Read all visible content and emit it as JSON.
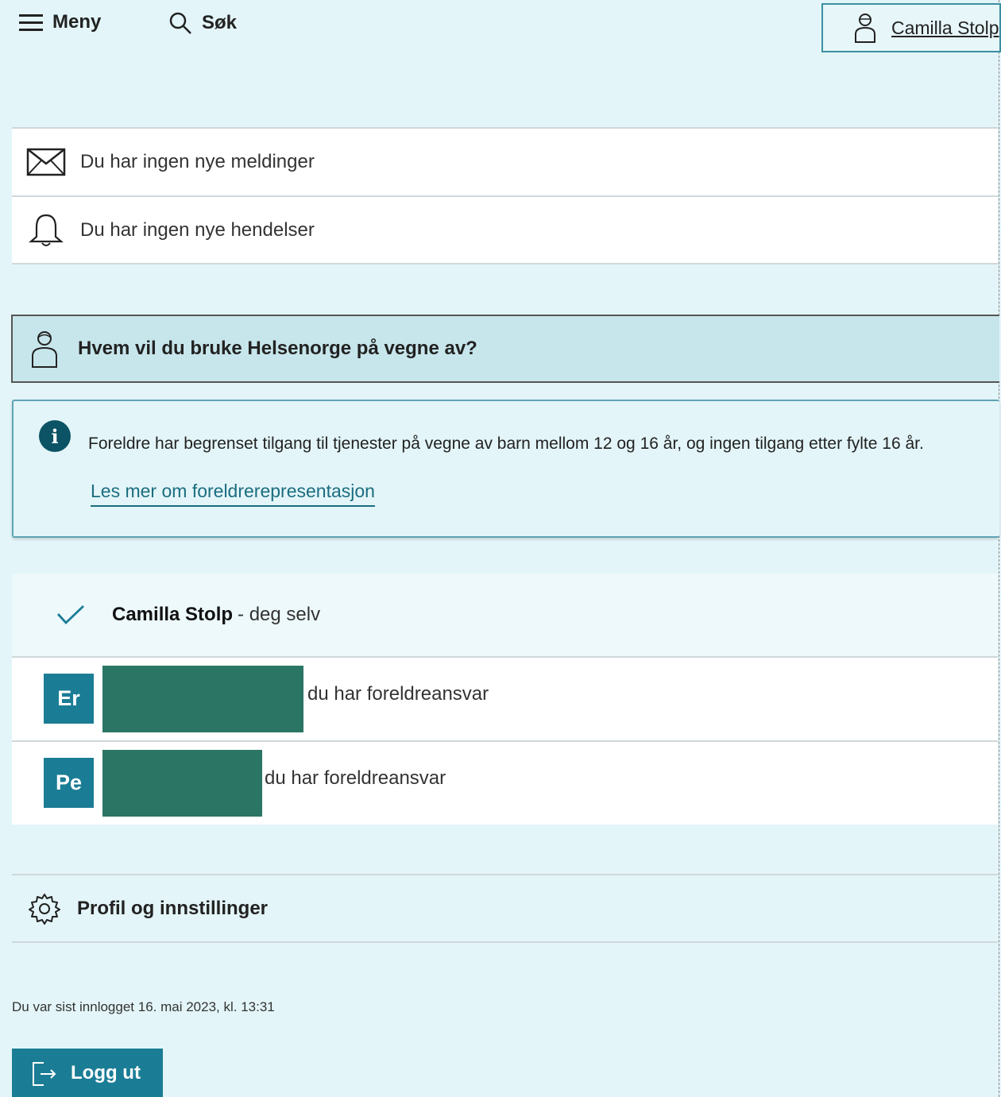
{
  "header": {
    "menu_label": "Meny",
    "search_label": "Søk",
    "user_label": "Camilla Stolp"
  },
  "notices": {
    "messages": "Du har ingen nye meldinger",
    "events": "Du har ingen nye hendelser"
  },
  "representation": {
    "heading": "Hvem vil du bruke Helsenorge på vegne av?",
    "info_text": "Foreldre har begrenset tilgang til tjenester på vegne av barn mellom 12 og 16 år, og ingen tilgang etter fylte 16 år.",
    "info_link": "Les mer om foreldrerepresentasjon",
    "self": {
      "name": "Camilla Stolp",
      "suffix": "- deg selv"
    },
    "children": [
      {
        "initials": "Er",
        "suffix": "du har foreldreansvar"
      },
      {
        "initials": "Pe",
        "suffix": "du har foreldreansvar"
      }
    ]
  },
  "profile_label": "Profil og innstillinger",
  "last_login": "Du var sist innlogget 16. mai 2023, kl. 13:31",
  "logout_label": "Logg ut",
  "colors": {
    "page_bg": "#e3f5f8",
    "accent": "#1b7d95",
    "redaction": "#2b7564"
  }
}
